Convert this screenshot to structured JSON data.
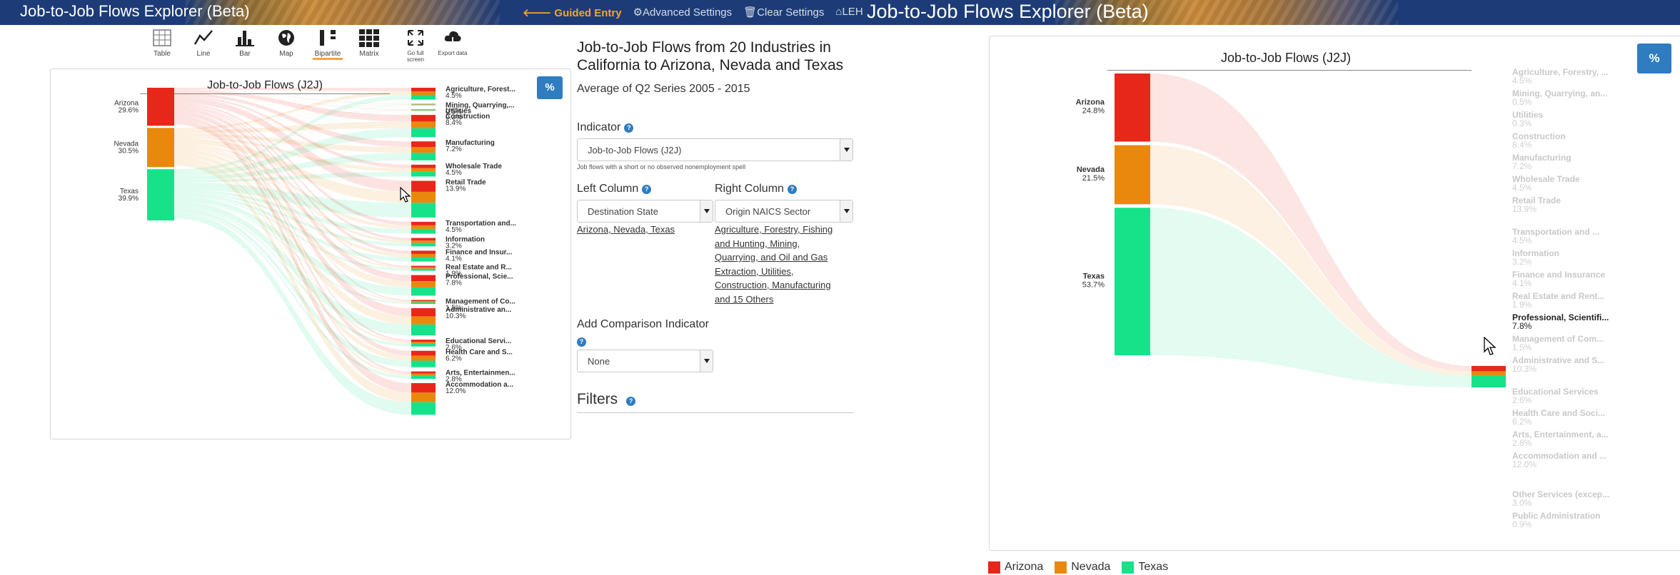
{
  "app": {
    "title": "Job-to-Job Flows Explorer (Beta)",
    "nav": [
      {
        "icon": "arrow-left-icon",
        "glyph": "🡐",
        "label": "Guided Entry"
      },
      {
        "icon": "gear-icon",
        "glyph": "⚙",
        "label": "Advanced Settings"
      },
      {
        "icon": "trash-icon",
        "glyph": "🗑",
        "label": "Clear Settings"
      },
      {
        "icon": "home-icon",
        "glyph": "⌂",
        "label": "LEHD Home"
      }
    ]
  },
  "toolbar": {
    "views": [
      "Table",
      "Line",
      "Bar",
      "Map",
      "Bipartite",
      "Matrix"
    ],
    "active": "Bipartite",
    "actions": [
      "Go full screen",
      "Export data"
    ]
  },
  "chart": {
    "title": "Job-to-Job Flows (J2J)",
    "pct_label": "%"
  },
  "chart_data": {
    "type": "bipartite",
    "title": "Job-to-Job Flows (J2J)",
    "colors": {
      "Arizona": "#e8271b",
      "Nevada": "#e8890e",
      "Texas": "#16e28a"
    },
    "left_view": {
      "states": [
        {
          "name": "Arizona",
          "pct": "29.6%"
        },
        {
          "name": "Nevada",
          "pct": "30.5%"
        },
        {
          "name": "Texas",
          "pct": "39.9%"
        }
      ],
      "industries": [
        {
          "name": "Agriculture, Forest...",
          "pct": "4.5%"
        },
        {
          "name": "Mining, Quarrying,...",
          "pct": "0.5%"
        },
        {
          "name": "Utilities",
          "pct": "0.3%"
        },
        {
          "name": "Construction",
          "pct": "8.4%"
        },
        {
          "name": "Manufacturing",
          "pct": "7.2%"
        },
        {
          "name": "Wholesale Trade",
          "pct": "4.5%"
        },
        {
          "name": "Retail Trade",
          "pct": "13.9%"
        },
        {
          "name": "Transportation and...",
          "pct": "4.5%"
        },
        {
          "name": "Information",
          "pct": "3.2%"
        },
        {
          "name": "Finance and Insur...",
          "pct": "4.1%"
        },
        {
          "name": "Real Estate and R...",
          "pct": "1.9%"
        },
        {
          "name": "Professional, Scie...",
          "pct": "7.8%"
        },
        {
          "name": "Management of Co...",
          "pct": "1.5%"
        },
        {
          "name": "Administrative an...",
          "pct": "10.3%"
        },
        {
          "name": "Educational Servi...",
          "pct": "2.6%"
        },
        {
          "name": "Health Care and S...",
          "pct": "6.2%"
        },
        {
          "name": "Arts, Entertainmen...",
          "pct": "2.8%"
        },
        {
          "name": "Accommodation a...",
          "pct": "12.0%"
        }
      ]
    },
    "right_view": {
      "states": [
        {
          "name": "Arizona",
          "pct": "24.8%"
        },
        {
          "name": "Nevada",
          "pct": "21.5%"
        },
        {
          "name": "Texas",
          "pct": "53.7%"
        }
      ],
      "highlighted": "Professional, Scientifi...",
      "industries": [
        {
          "name": "Agriculture, Forestry, ...",
          "pct": "4.5%"
        },
        {
          "name": "Mining, Quarrying, an...",
          "pct": "0.5%"
        },
        {
          "name": "Utilities",
          "pct": "0.3%"
        },
        {
          "name": "Construction",
          "pct": "8.4%"
        },
        {
          "name": "Manufacturing",
          "pct": "7.2%"
        },
        {
          "name": "Wholesale Trade",
          "pct": "4.5%"
        },
        {
          "name": "Retail Trade",
          "pct": "13.9%"
        },
        {
          "name": "Transportation and ...",
          "pct": "4.5%"
        },
        {
          "name": "Information",
          "pct": "3.2%"
        },
        {
          "name": "Finance and Insurance",
          "pct": "4.1%"
        },
        {
          "name": "Real Estate and Rent...",
          "pct": "1.9%"
        },
        {
          "name": "Professional, Scientifi...",
          "pct": "7.8%"
        },
        {
          "name": "Management of Com...",
          "pct": "1.5%"
        },
        {
          "name": "Administrative and S...",
          "pct": "10.3%"
        },
        {
          "name": "Educational Services",
          "pct": "2.6%"
        },
        {
          "name": "Health Care and Soci...",
          "pct": "6.2%"
        },
        {
          "name": "Arts, Entertainment, a...",
          "pct": "2.8%"
        },
        {
          "name": "Accommodation and ...",
          "pct": "12.0%"
        },
        {
          "name": "Other Services (excep...",
          "pct": "3.0%"
        },
        {
          "name": "Public Administration",
          "pct": "0.9%"
        }
      ]
    },
    "legend": [
      "Arizona",
      "Nevada",
      "Texas"
    ]
  },
  "panel": {
    "heading": "Job-to-Job Flows from 20 Industries in California to Arizona, Nevada and Texas",
    "subheading": "Average of Q2 Series 2005 - 2015",
    "indicator_label": "Indicator",
    "indicator_value": "Job-to-Job Flows (J2J)",
    "indicator_hint": "Job flows with a short or no observed nonemployment spell",
    "left_column_label": "Left Column",
    "left_column_value": "Destination State",
    "left_column_link": "Arizona, Nevada, Texas",
    "right_column_label": "Right Column",
    "right_column_value": "Origin NAICS Sector",
    "right_column_link": [
      "Agriculture, Forestry, Fishing",
      "and Hunting, Mining,",
      "Quarrying, and Oil and Gas",
      "Extraction, Utilities,",
      "Construction, Manufacturing",
      "and 15 Others"
    ],
    "comparison_label": "Add Comparison Indicator",
    "comparison_value": "None",
    "filters_label": "Filters"
  }
}
